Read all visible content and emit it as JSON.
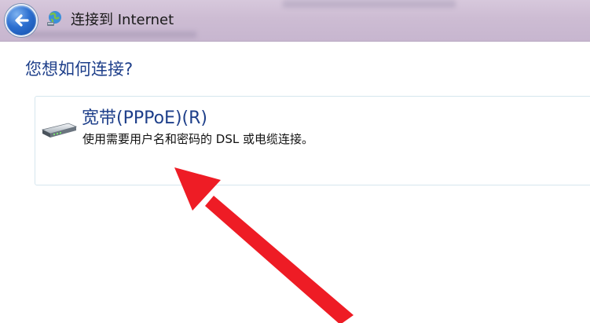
{
  "window": {
    "title": "连接到 Internet"
  },
  "icons": {
    "back": "back-arrow-icon",
    "network": "globe-network-icon",
    "modem": "broadband-modem-icon"
  },
  "main": {
    "question": "您想如何连接?",
    "options": [
      {
        "title": "宽带(PPPoE)(R)",
        "description": "使用需要用户名和密码的 DSL 或电缆连接。"
      }
    ]
  },
  "colors": {
    "accent_text": "#1e3f8a",
    "annotation_arrow": "#ee1c25"
  }
}
